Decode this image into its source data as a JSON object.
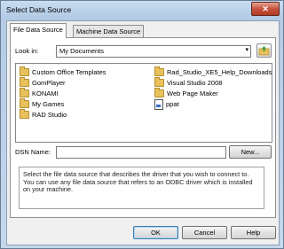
{
  "window": {
    "title": "Select Data Source",
    "close_label": "✕"
  },
  "tabs": [
    {
      "label": "File Data Source"
    },
    {
      "label": "Machine Data Source"
    }
  ],
  "lookin": {
    "label": "Look in:",
    "value": "My Documents"
  },
  "files": [
    {
      "name": "Custom Office Templates",
      "icon": "folder-icon"
    },
    {
      "name": "GomPlayer",
      "icon": "folder-icon"
    },
    {
      "name": "KONAMI",
      "icon": "folder-icon"
    },
    {
      "name": "My Games",
      "icon": "folder-icon"
    },
    {
      "name": "RAD Studio",
      "icon": "folder-icon"
    },
    {
      "name": "Rad_Studio_XE5_Help_Downloads",
      "icon": "folder-icon"
    },
    {
      "name": "Visual Studio 2008",
      "icon": "folder-icon"
    },
    {
      "name": "Web Page Maker",
      "icon": "folder-icon"
    },
    {
      "name": "ppat",
      "icon": "file-icon"
    }
  ],
  "dsn": {
    "label": "DSN Name:",
    "value": "",
    "new_label": "New..."
  },
  "description": "Select the file data source that describes the driver that you wish to connect to. You can use any file data source that refers to an ODBC driver which is installed on your machine.",
  "buttons": {
    "ok": "OK",
    "cancel": "Cancel",
    "help": "Help"
  }
}
